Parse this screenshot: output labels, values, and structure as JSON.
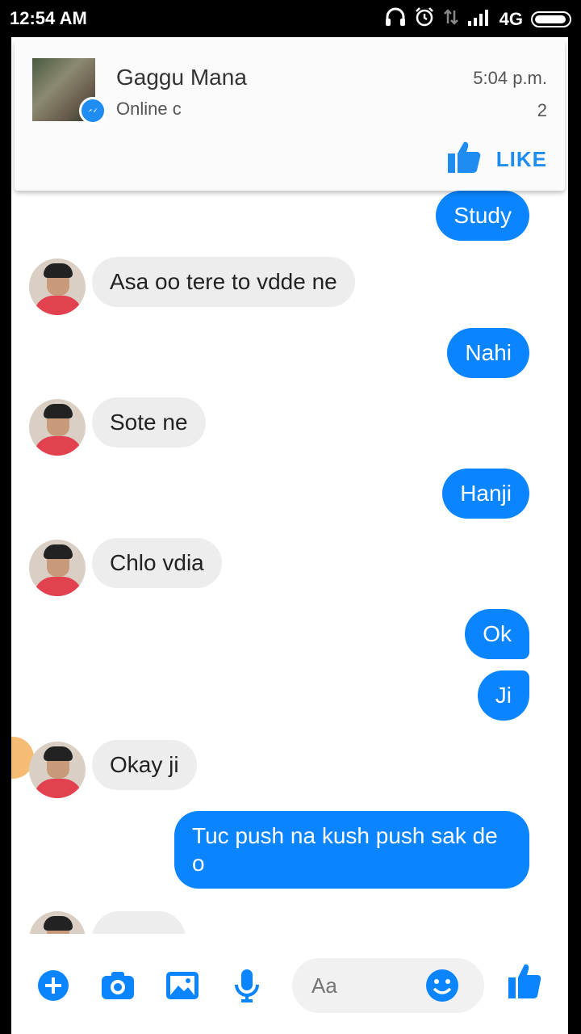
{
  "status_bar": {
    "time": "12:54 AM",
    "network": "4G",
    "icons": [
      "headphones-icon",
      "alarm-icon",
      "data-icon",
      "signal-icon",
      "battery-icon"
    ]
  },
  "notification": {
    "sender_name": "Gaggu Mana",
    "subtitle": "Online c",
    "time": "5:04 p.m.",
    "count": "2",
    "like_label": "LIKE"
  },
  "messages": [
    {
      "direction": "out",
      "text": "Study"
    },
    {
      "direction": "in",
      "text": "Asa oo tere to vdde ne"
    },
    {
      "direction": "out",
      "text": "Nahi"
    },
    {
      "direction": "in",
      "text": "Sote ne"
    },
    {
      "direction": "out",
      "text": "Hanji"
    },
    {
      "direction": "in",
      "text": "Chlo vdia"
    },
    {
      "direction": "out",
      "text": "Ok"
    },
    {
      "direction": "out",
      "text": "Ji"
    },
    {
      "direction": "in",
      "text": "Okay ji"
    },
    {
      "direction": "out",
      "text": "Tuc push na kush push sak de o"
    }
  ],
  "composer": {
    "placeholder": "Aa",
    "icons": [
      "add-icon",
      "camera-icon",
      "gallery-icon",
      "microphone-icon",
      "emoji-icon",
      "thumbs-up-icon"
    ]
  },
  "colors": {
    "accent": "#0A84FF",
    "incoming_bubble": "#EDEDED",
    "status_bar": "#000000"
  }
}
